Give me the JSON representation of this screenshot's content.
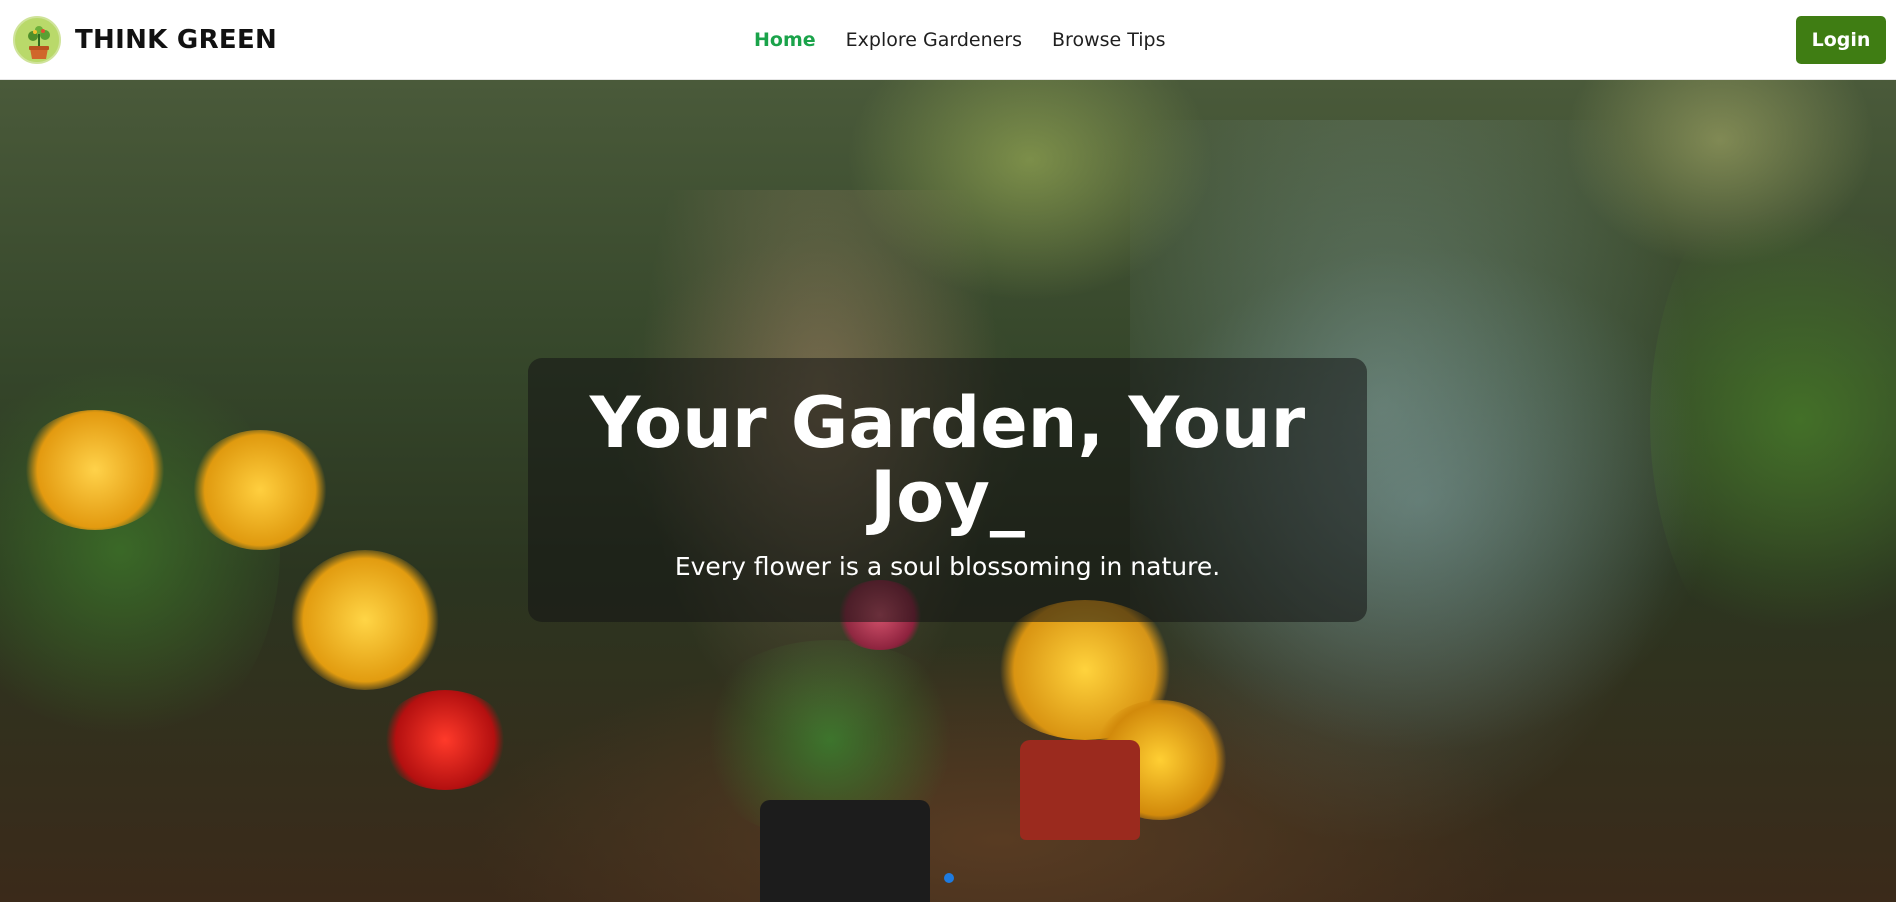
{
  "header": {
    "brand_name": "THINK GREEN",
    "nav": [
      {
        "label": "Home",
        "active": true
      },
      {
        "label": "Explore Gardeners",
        "active": false
      },
      {
        "label": "Browse Tips",
        "active": false
      }
    ],
    "login_label": "Login"
  },
  "hero": {
    "title": "Your Garden, Your Joy_",
    "subtitle": "Every flower is a soul blossoming in nature."
  },
  "colors": {
    "accent_active": "#1aa34a",
    "login_button": "#3f7d13"
  },
  "icons": {
    "logo": "potted-plant-logo-icon"
  }
}
